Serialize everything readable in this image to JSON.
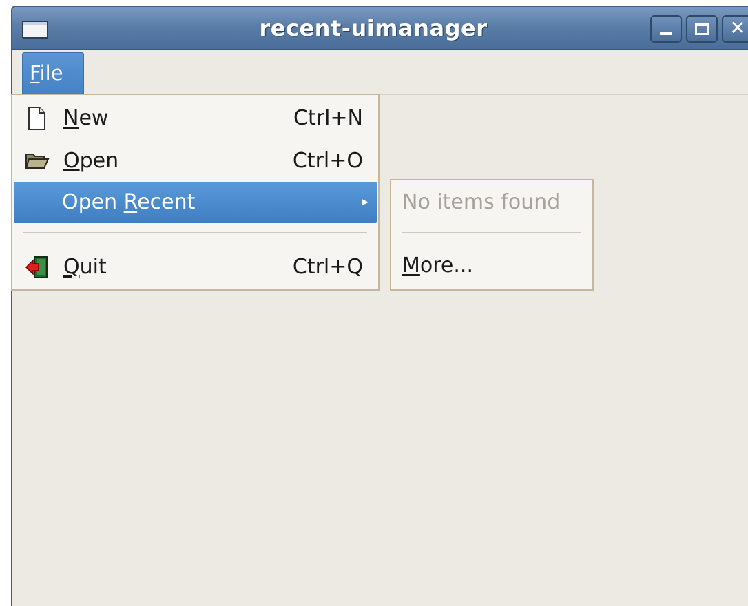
{
  "window": {
    "title": "recent-uimanager",
    "controls": {
      "minimize": "minimize",
      "maximize": "maximize",
      "close": "✕"
    }
  },
  "menubar": {
    "file": {
      "mnemonic": "F",
      "rest": "ile"
    }
  },
  "file_menu": {
    "new": {
      "pre": "",
      "mnemonic": "N",
      "rest": "ew",
      "accel": "Ctrl+N",
      "icon": "document-new-icon"
    },
    "open": {
      "pre": "",
      "mnemonic": "O",
      "rest": "pen",
      "accel": "Ctrl+O",
      "icon": "folder-open-icon"
    },
    "open_recent": {
      "pre": "Open ",
      "mnemonic": "R",
      "rest": "ecent",
      "arrow": "▸"
    },
    "quit": {
      "pre": "",
      "mnemonic": "Q",
      "rest": "uit",
      "accel": "Ctrl+Q",
      "icon": "exit-door-icon"
    }
  },
  "recent_submenu": {
    "empty_label": "No items found",
    "more": {
      "mnemonic": "M",
      "rest": "ore..."
    }
  },
  "colors": {
    "titlebar": "#5b7ea8",
    "selection": "#4a8acb",
    "window_bg": "#ede9e3",
    "menu_bg": "#f7f5f2"
  }
}
